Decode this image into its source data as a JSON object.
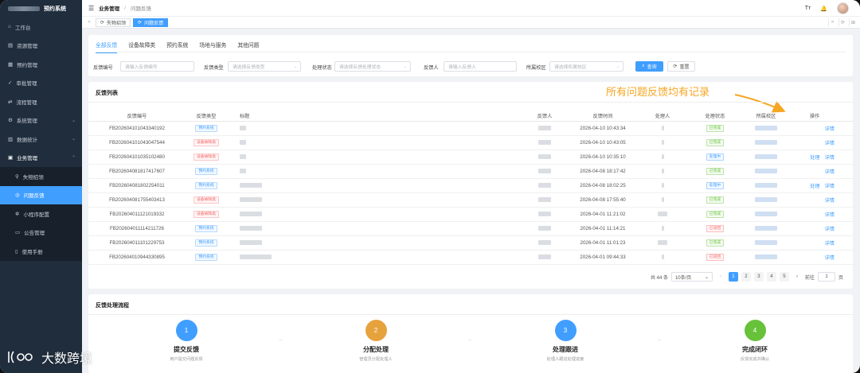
{
  "app": {
    "title": "预约系统"
  },
  "sidebar": {
    "items": [
      {
        "label": "工作台",
        "icon": "home-icon"
      },
      {
        "label": "资源管理",
        "icon": "database-icon"
      },
      {
        "label": "预约管理",
        "icon": "calendar-icon"
      },
      {
        "label": "审批管理",
        "icon": "check-icon"
      },
      {
        "label": "流程管理",
        "icon": "flow-icon"
      },
      {
        "label": "系统管理",
        "icon": "gear-icon"
      },
      {
        "label": "数据统计",
        "icon": "chart-icon"
      },
      {
        "label": "业务管理",
        "icon": "briefcase-icon"
      }
    ],
    "subitems": [
      {
        "label": "失物招领",
        "icon": "location-icon"
      },
      {
        "label": "问题反馈",
        "icon": "chat-icon"
      },
      {
        "label": "小程序配置",
        "icon": "settings-icon"
      },
      {
        "label": "公告管理",
        "icon": "monitor-icon"
      },
      {
        "label": "使用手册",
        "icon": "book-icon"
      }
    ]
  },
  "topbar": {
    "breadcrumb_parent": "业务管理",
    "breadcrumb_current": "问题反馈"
  },
  "tabs": [
    {
      "label": "失物招领"
    },
    {
      "label": "问题反馈"
    }
  ],
  "filter": {
    "categories": [
      "全部反馈",
      "设备故障类",
      "预约系统",
      "场地与服务",
      "其他问题"
    ],
    "fields": {
      "no_label": "反馈编号",
      "no_placeholder": "请输入反馈编号",
      "type_label": "反馈类型",
      "type_placeholder": "请选择反馈类型",
      "status_label": "处理状态",
      "status_placeholder": "请选择反馈处理状态",
      "user_label": "反馈人",
      "user_placeholder": "请输入反馈人",
      "school_label": "所属校区",
      "school_placeholder": "请选择所属校区"
    },
    "search_label": "查询",
    "reset_label": "重置"
  },
  "list": {
    "title": "反馈列表",
    "annotation": "所有问题反馈均有记录",
    "columns": [
      "反馈编号",
      "反馈类型",
      "标题",
      "反馈人",
      "反馈时间",
      "处理人",
      "处理状态",
      "所属校区",
      "操作"
    ],
    "rows": [
      {
        "no": "FB202604101043340192",
        "type": "预约系统",
        "time": "2026-04-10 10:43:34",
        "status": "已完成",
        "ops": [
          "详情"
        ]
      },
      {
        "no": "FB202604101043047544",
        "type": "设备故障类",
        "time": "2026-04-10 10:43:05",
        "status": "已完成",
        "ops": [
          "详情"
        ]
      },
      {
        "no": "FB202604101035102480",
        "type": "设备故障类",
        "time": "2026-04-10 10:35:10",
        "status": "处理中",
        "ops": [
          "处理",
          "详情"
        ]
      },
      {
        "no": "FB202604081817417607",
        "type": "预约系统",
        "time": "2026-04-08 18:17:42",
        "status": "已完成",
        "ops": [
          "详情"
        ]
      },
      {
        "no": "FB202604081802254011",
        "type": "预约系统",
        "time": "2026-04-08 18:02:25",
        "status": "处理中",
        "ops": [
          "处理",
          "详情"
        ]
      },
      {
        "no": "FB202604081755403413",
        "type": "设备故障类",
        "time": "2026-04-08 17:55:40",
        "status": "已完成",
        "ops": [
          "详情"
        ]
      },
      {
        "no": "FB202604011121019332",
        "type": "设备故障类",
        "time": "2026-04-01 11:21:02",
        "status": "已完成",
        "ops": [
          "详情"
        ]
      },
      {
        "no": "FB202604011114211726",
        "type": "预约系统",
        "time": "2026-04-01 11:14:21",
        "status": "已驳回",
        "ops": [
          "详情"
        ]
      },
      {
        "no": "FB202604011101229753",
        "type": "预约系统",
        "time": "2026-04-01 11:01:23",
        "status": "已完成",
        "ops": [
          "详情"
        ]
      },
      {
        "no": "FB202604010944330895",
        "type": "预约系统",
        "time": "2026-04-01 09:44:33",
        "status": "已驳回",
        "ops": [
          "详情"
        ]
      }
    ]
  },
  "pager": {
    "total": "共 44 条",
    "page_size": "10条/页",
    "pages": [
      "1",
      "2",
      "3",
      "4",
      "5"
    ],
    "goto": "前往",
    "page_input": "1",
    "page_unit": "页"
  },
  "flow": {
    "title": "反馈处理流程",
    "steps": [
      {
        "num": "1",
        "title": "提交反馈",
        "desc": "用户提交问题反馈",
        "color": "#409eff"
      },
      {
        "num": "2",
        "title": "分配处理",
        "desc": "管理员分配处理人",
        "color": "#e6a23c"
      },
      {
        "num": "3",
        "title": "处理跟进",
        "desc": "处理人跟进处理进度",
        "color": "#409eff"
      },
      {
        "num": "4",
        "title": "完成闭环",
        "desc": "反馈完成并确认",
        "color": "#67c23a"
      }
    ]
  },
  "watermark": {
    "text": "大数跨境"
  },
  "colors": {
    "primary": "#409eff",
    "sidebar_bg": "#1f2d3d",
    "tag_booking": "#409eff",
    "tag_device": "#f56c6c",
    "status_done": "#67c23a",
    "status_processing": "#409eff",
    "status_rejected": "#f56c6c"
  }
}
